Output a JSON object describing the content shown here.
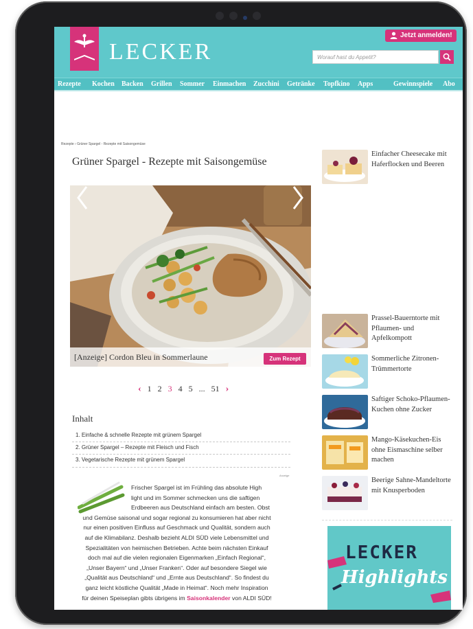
{
  "header": {
    "logo_text": "LECKER",
    "login_label": "Jetzt anmelden!",
    "search_placeholder": "Worauf hast du Appetit?"
  },
  "nav": {
    "items": [
      "Rezepte",
      "Kochen",
      "Backen",
      "Grillen",
      "Sommer",
      "Einmachen",
      "Zucchini",
      "Getränke",
      "Topfkino",
      "Apps",
      "Gewinnspiele",
      "Abo"
    ]
  },
  "breadcrumb": "Rezepte › Grüner Spargel - Rezepte mit Saisongemüse",
  "article": {
    "title": "Grüner Spargel - Rezepte mit Saisongemüse",
    "hero_caption": "[Anzeige] Cordon Bleu in Sommerlaune",
    "hero_button": "Zum Rezept",
    "pagination": {
      "prev": "‹",
      "pages": [
        "1",
        "2",
        "3",
        "4",
        "5",
        "...",
        "51"
      ],
      "current": "3",
      "next": "›"
    },
    "toc_title": "Inhalt",
    "toc": [
      "1. Einfache & schnelle Rezepte mit grünem Spargel",
      "2. Grüner Spargel – Rezepte mit Fleisch und Fisch",
      "3. Vegetarische Rezepte mit grünem Spargel"
    ],
    "ad_label": "Anzeige",
    "intro_lines": [
      "Frischer Spargel ist im Frühling das absolute High",
      "light und im Sommer schmecken uns die saftigen",
      "Erdbeeren aus Deutschland einfach am besten. Obst"
    ],
    "body_lines": [
      "und Gemüse saisonal und sogar regional zu konsumieren hat aber nicht",
      "nur einen positiven Einfluss auf Geschmack und Qualität, sondern auch",
      "auf die Klimabilanz. Deshalb bezieht ALDI SÜD viele Lebensmittel und",
      "Spezialitäten von heimischen Betrieben. Achte beim nächsten Einkauf",
      "doch mal auf die vielen regionalen Eigenmarken „Einfach Regional“,",
      "„Unser Bayern“ und „Unser Franken“. Oder auf besondere Siegel wie",
      "„Qualität aus Deutschland“ und „Ernte aus Deutschland“. So findest du",
      "ganz leicht köstliche Qualität „Made in Heimat“. Noch mehr Inspiration"
    ],
    "last_line_pre": "für deinen Speiseplan gibts übrigens im",
    "last_line_link": "Saisonkalender",
    "last_line_post": "von ALDI SÜD!"
  },
  "sidebar": {
    "cards": [
      {
        "title": "Einfacher Cheesecake mit Haferflocken und Beeren"
      },
      {
        "title": "Prassel-Bauerntorte mit Pflaumen- und Apfelkompott"
      },
      {
        "title": "Sommerliche Zitronen-Trümmertorte"
      },
      {
        "title": "Saftiger Schoko-Pflaumen-Kuchen ohne Zucker"
      },
      {
        "title": "Mango-Käsekuchen-Eis ohne Eismaschine selber machen"
      },
      {
        "title": "Beerige Sahne-Mandeltorte mit Knusperboden"
      }
    ],
    "banner_line1": "LECKER",
    "banner_line2": "Highlights"
  },
  "colors": {
    "brand_teal": "#5fc8cb",
    "brand_pink": "#d6337a"
  }
}
